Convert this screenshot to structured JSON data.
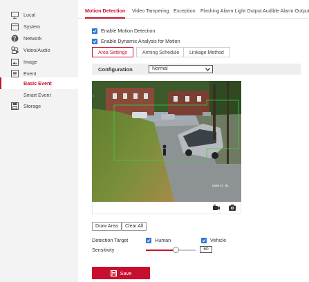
{
  "sidebar": {
    "items": [
      {
        "label": "Local",
        "icon": "monitor-icon"
      },
      {
        "label": "System",
        "icon": "system-icon"
      },
      {
        "label": "Network",
        "icon": "network-globe-icon"
      },
      {
        "label": "Video/Audio",
        "icon": "video-audio-icon"
      },
      {
        "label": "Image",
        "icon": "image-icon"
      },
      {
        "label": "Event",
        "icon": "event-list-icon"
      },
      {
        "label": "Basic Event",
        "icon": ""
      },
      {
        "label": "Smart Event",
        "icon": ""
      },
      {
        "label": "Storage",
        "icon": "storage-disk-icon"
      }
    ],
    "active": "Basic Event"
  },
  "tabs": [
    "Motion Detection",
    "Video Tampering",
    "Exception",
    "Flashing Alarm Light Output",
    "Audible Alarm Output"
  ],
  "active_tab": "Motion Detection",
  "checkboxes": {
    "enable_motion": {
      "label": "Enable Motion Detection",
      "checked": true
    },
    "enable_dynamic": {
      "label": "Enable Dynamic Analysis for Motion",
      "checked": true
    }
  },
  "subtabs": [
    "Area Settings",
    "Arming Schedule",
    "Linkage Method"
  ],
  "active_subtab": "Area Settings",
  "configuration": {
    "label": "Configuration",
    "value": "Normal"
  },
  "video": {
    "camera_label": "Camera 01"
  },
  "buttons": {
    "draw_area": "Draw Area",
    "clear_all": "Clear All",
    "save": "Save"
  },
  "detection_target": {
    "label": "Detection Target",
    "human": {
      "label": "Human",
      "checked": true
    },
    "vehicle": {
      "label": "Vehicle",
      "checked": true
    }
  },
  "sensitivity": {
    "label": "Sensitivity",
    "value": "60",
    "level": 0.6
  },
  "colors": {
    "accent": "#c8102e",
    "checkbox": "#2c79d3",
    "detection_box": "#3ecf3e"
  }
}
